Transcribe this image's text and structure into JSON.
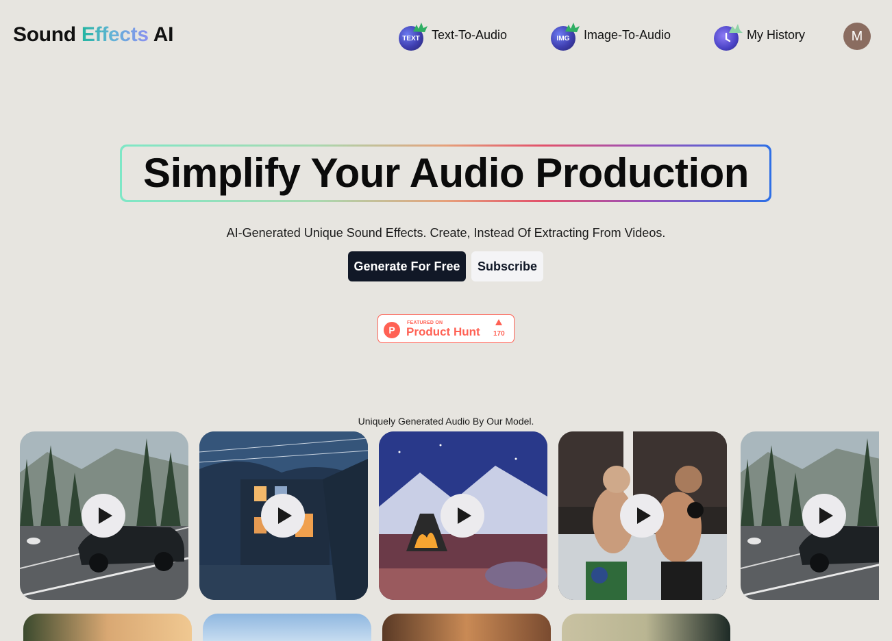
{
  "header": {
    "logo": {
      "part1": "Sound",
      "part2": "Effects",
      "part3": "AI"
    },
    "nav": [
      {
        "label": "Text-To-Audio",
        "icon_text": "TEXT",
        "icon": "text-audio-icon"
      },
      {
        "label": "Image-To-Audio",
        "icon_text": "IMG",
        "icon": "image-audio-icon"
      },
      {
        "label": "My History",
        "icon_text": "",
        "icon": "clock-icon"
      }
    ],
    "avatar_initial": "M"
  },
  "hero": {
    "title": "Simplify Your Audio Production",
    "subtitle": "AI-Generated Unique Sound Effects. Create, Instead Of Extracting From Videos.",
    "primary_button": "Generate For Free",
    "secondary_button": "Subscribe"
  },
  "product_hunt": {
    "small_text": "FEATURED ON",
    "name": "Product Hunt",
    "logo_letter": "P",
    "count": "170"
  },
  "gallery": {
    "caption": "Uniquely Generated Audio By Our Model.",
    "cards": [
      {
        "scene": "car-on-forest-road"
      },
      {
        "scene": "rainy-night-house"
      },
      {
        "scene": "cozy-fireplace-snow"
      },
      {
        "scene": "mma-fight"
      },
      {
        "scene": "car-on-forest-road"
      }
    ]
  },
  "colors": {
    "background": "#e7e5e0",
    "primary_button": "#111827",
    "product_hunt": "#ff6154",
    "logo_gradient_start": "#22b5a0",
    "logo_gradient_end": "#8a8ff0"
  }
}
